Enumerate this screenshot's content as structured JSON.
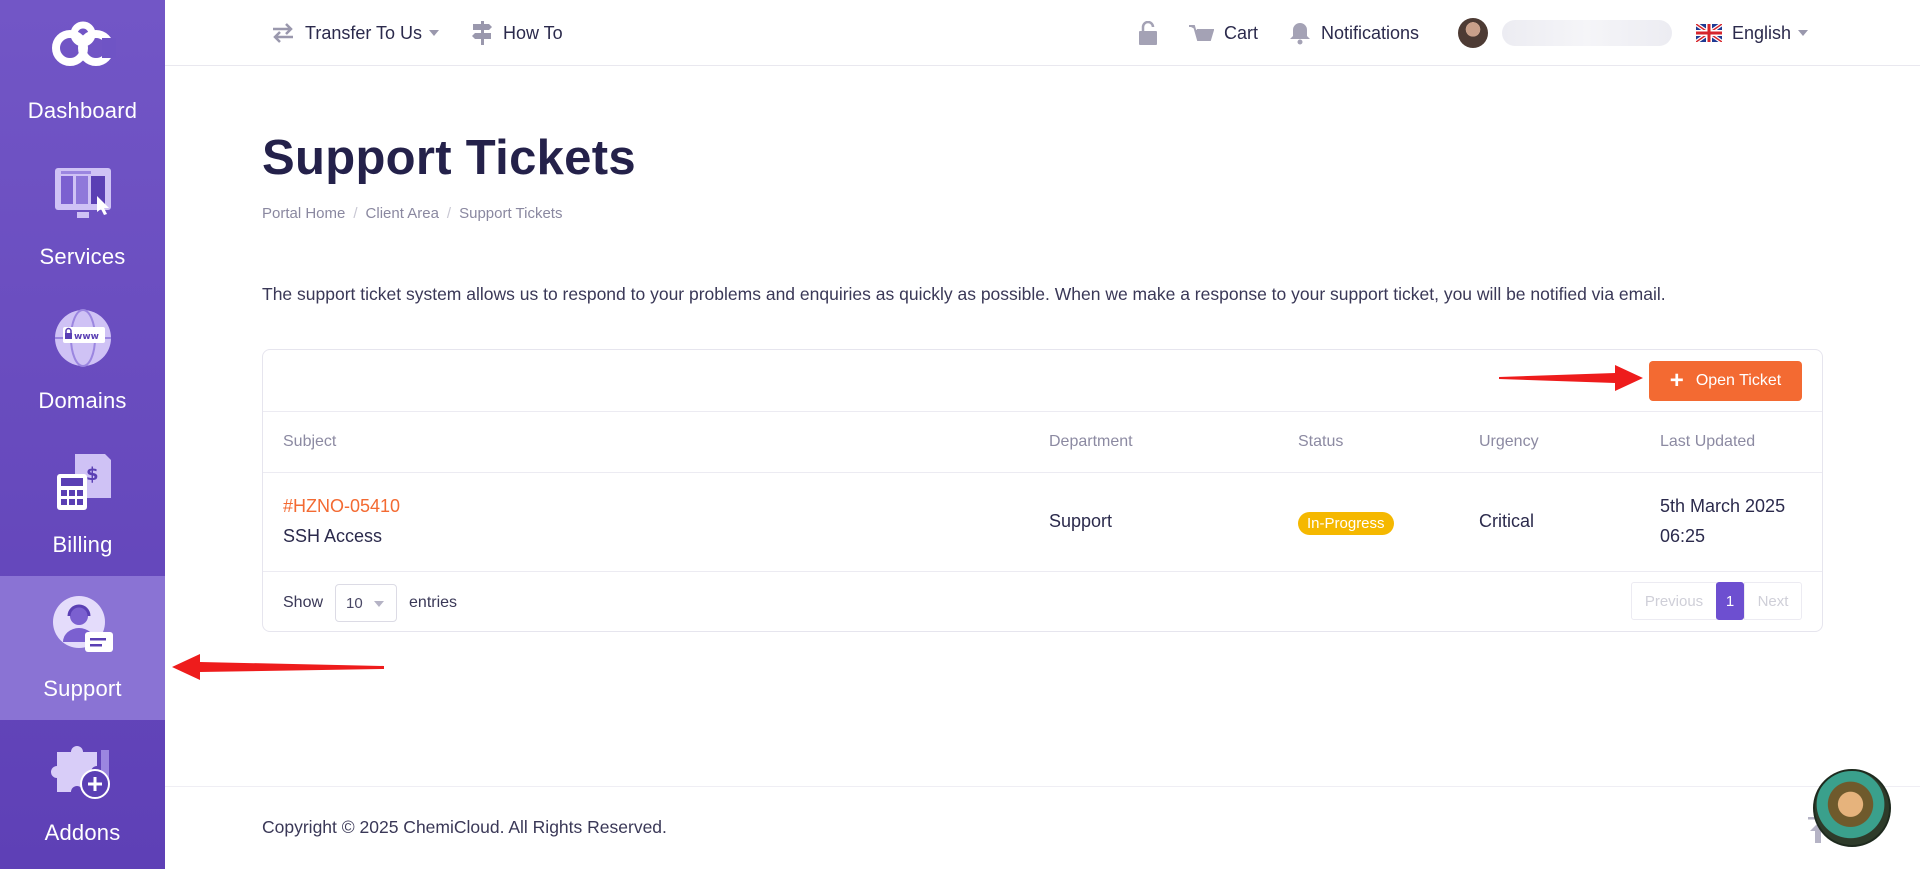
{
  "sidebar": {
    "items": [
      {
        "label": "Dashboard",
        "icon": "logo-icon"
      },
      {
        "label": "Services",
        "icon": "services-icon"
      },
      {
        "label": "Domains",
        "icon": "domains-icon"
      },
      {
        "label": "Billing",
        "icon": "billing-icon"
      },
      {
        "label": "Support",
        "icon": "support-icon",
        "active": true
      },
      {
        "label": "Addons",
        "icon": "addons-icon"
      }
    ],
    "domains_icon_text": "www"
  },
  "topnav": {
    "transfer": "Transfer To Us",
    "howto": "How To",
    "cart": "Cart",
    "notifications": "Notifications",
    "language": "English"
  },
  "page": {
    "title": "Support Tickets",
    "breadcrumb": [
      "Portal Home",
      "Client Area",
      "Support Tickets"
    ],
    "intro": "The support ticket system allows us to respond to your problems and enquiries as quickly as possible. When we make a response to your support ticket, you will be notified via email."
  },
  "table": {
    "open_ticket_label": "Open Ticket",
    "headers": {
      "subject": "Subject",
      "department": "Department",
      "status": "Status",
      "urgency": "Urgency",
      "last_updated": "Last Updated"
    },
    "rows": [
      {
        "id": "#HZNO-05410",
        "subject": "SSH Access",
        "department": "Support",
        "status": "In-Progress",
        "urgency": "Critical",
        "updated_date": "5th March 2025",
        "updated_time": "06:25"
      }
    ],
    "show_label": "Show",
    "entries_value": "10",
    "entries_label": "entries",
    "pager": {
      "previous": "Previous",
      "current": "1",
      "next": "Next"
    }
  },
  "footer": {
    "copyright": "Copyright © 2025 ChemiCloud. All Rights Reserved."
  },
  "colors": {
    "sidebar": "#6a4fc4",
    "accent": "#f36a32",
    "status_badge": "#f5b800",
    "pager_active": "#6d4fd0",
    "annotation_arrow": "#ee1c1c"
  }
}
